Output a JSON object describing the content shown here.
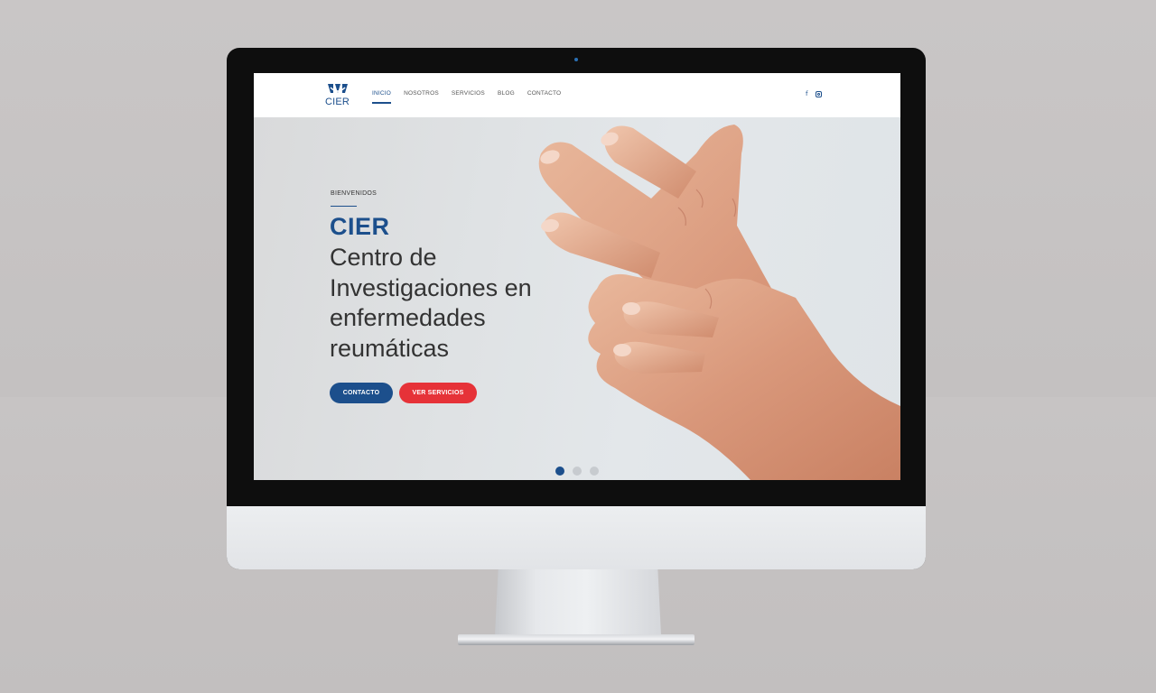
{
  "nav": {
    "logo_text": "CIER",
    "links": [
      {
        "label": "INICIO",
        "active": true
      },
      {
        "label": "NOSOTROS",
        "active": false
      },
      {
        "label": "SERVICIOS",
        "active": false
      },
      {
        "label": "BLOG",
        "active": false
      },
      {
        "label": "CONTACTO",
        "active": false
      }
    ],
    "social": [
      "facebook-icon",
      "instagram-icon"
    ],
    "facebook_glyph": "f"
  },
  "hero": {
    "eyebrow": "BIENVENIDOS",
    "title": "CIER",
    "subtitle_lines": [
      "Centro de",
      "Investigaciones en",
      "enfermedades",
      "reumáticas"
    ],
    "buttons": {
      "contact": "CONTACTO",
      "services": "VER SERVICIOS"
    },
    "carousel": {
      "count": 3,
      "active_index": 0
    }
  },
  "colors": {
    "brand_blue": "#1c4f8c",
    "accent_red": "#e63238"
  }
}
